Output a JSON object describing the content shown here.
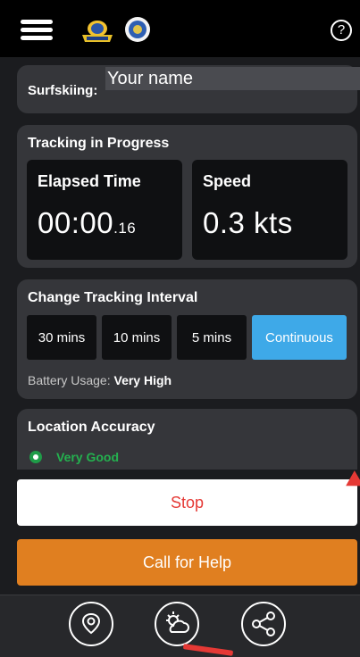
{
  "topbar": {
    "help_label": "?"
  },
  "name_card": {
    "label": "Surfskiing:",
    "placeholder": "Your name"
  },
  "tracking": {
    "title": "Tracking in Progress",
    "elapsed_label": "Elapsed Time",
    "elapsed_main": "00:00",
    "elapsed_fraction": ".16",
    "speed_label": "Speed",
    "speed_value": "0.3 kts"
  },
  "interval": {
    "title": "Change Tracking Interval",
    "options": [
      "30 mins",
      "10 mins",
      "5 mins",
      "Continuous"
    ],
    "selected": "Continuous",
    "battery_label": "Battery Usage:",
    "battery_value": "Very High"
  },
  "accuracy": {
    "title": "Location Accuracy",
    "value": "Very Good"
  },
  "actions": {
    "stop_label": "Stop",
    "help_label": "Call for Help"
  },
  "bottom_nav": {
    "items": [
      "location-pin-icon",
      "weather-icon",
      "share-icon"
    ]
  },
  "colors": {
    "accent_blue": "#3ea9e8",
    "stop_red": "#e53935",
    "help_orange": "#e07f20",
    "good_green": "#24b14f"
  }
}
